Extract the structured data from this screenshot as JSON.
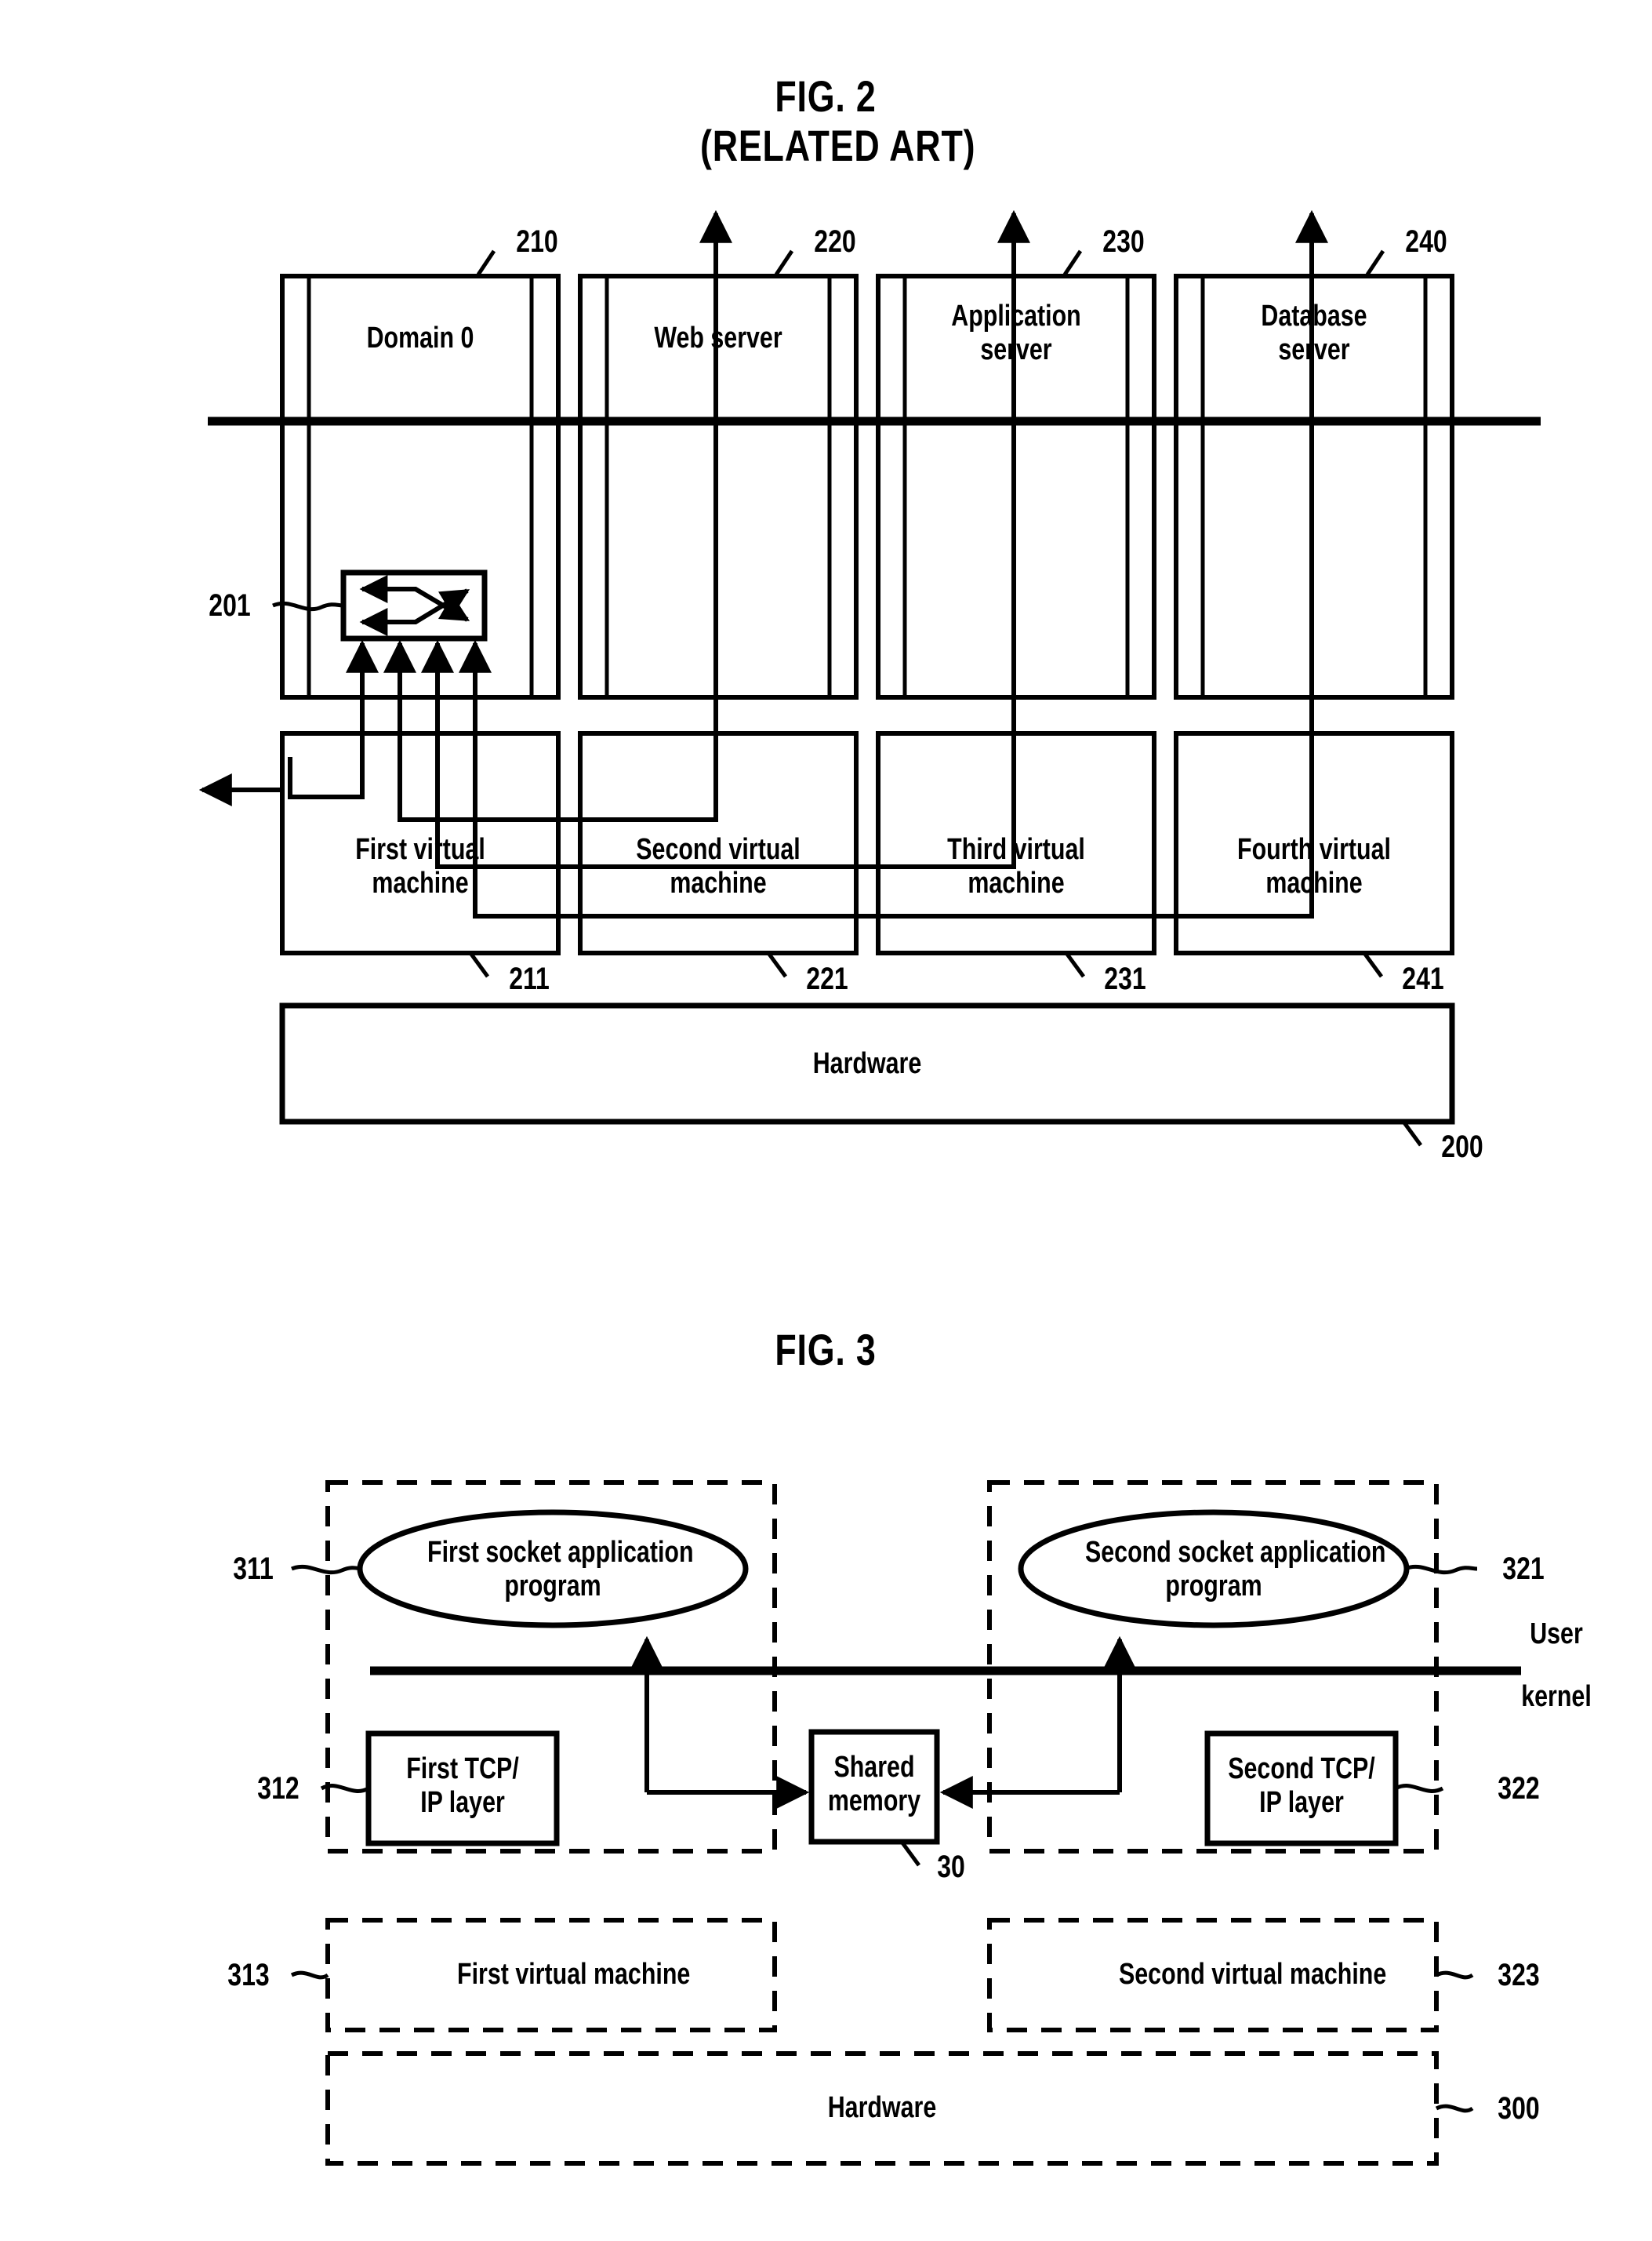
{
  "figures": [
    {
      "id": "fig2",
      "title": "FIG. 2",
      "subtitle": "(RELATED ART)",
      "top_boxes": [
        {
          "label": "Domain 0",
          "ref": "210"
        },
        {
          "label": "Web server",
          "ref": "220"
        },
        {
          "label": "Application\nserver",
          "ref": "230"
        },
        {
          "label": "Database\nserver",
          "ref": "240"
        }
      ],
      "switch": {
        "ref": "201",
        "name": "virtual switch"
      },
      "vm_boxes": [
        {
          "label": "First virtual\nmachine",
          "ref": "211"
        },
        {
          "label": "Second virtual\nmachine",
          "ref": "221"
        },
        {
          "label": "Third virtual\nmachine",
          "ref": "231"
        },
        {
          "label": "Fourth virtual\nmachine",
          "ref": "241"
        }
      ],
      "hardware": {
        "label": "Hardware",
        "ref": "200"
      }
    },
    {
      "id": "fig3",
      "title": "FIG. 3",
      "subtitle": "",
      "left_domain": {
        "app": {
          "label": "First socket application\nprogram",
          "ref": "311"
        },
        "tcp": {
          "label": "First TCP/\nIP layer",
          "ref": "312"
        },
        "vm": {
          "label": "First virtual machine",
          "ref": "313"
        }
      },
      "right_domain": {
        "app": {
          "label": "Second socket application\nprogram",
          "ref": "321"
        },
        "tcp": {
          "label": "Second TCP/\nIP layer",
          "ref": "322"
        },
        "vm": {
          "label": "Second virtual machine",
          "ref": "323"
        }
      },
      "shared_memory": {
        "label": "Shared\nmemory",
        "ref": "30"
      },
      "boundary": {
        "upper": "User",
        "lower": "kernel"
      },
      "hardware": {
        "label": "Hardware",
        "ref": "300"
      }
    }
  ],
  "colors": {
    "ink": "#000000",
    "paper": "#ffffff"
  }
}
